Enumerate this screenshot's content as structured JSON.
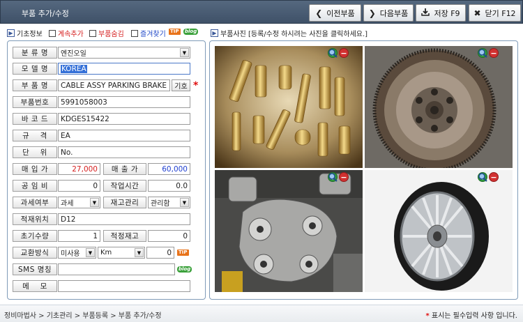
{
  "window": {
    "title": "부품 추가/수정"
  },
  "toolbar": {
    "prev": {
      "label": "이전부품",
      "icon": "chevron-left-icon"
    },
    "next": {
      "label": "다음부품",
      "icon": "chevron-right-icon"
    },
    "save": {
      "label": "저장 F9",
      "icon": "download-icon"
    },
    "close": {
      "label": "닫기 F12",
      "icon": "close-icon"
    }
  },
  "infobar": {
    "basic": "기초정보",
    "continue_add": "계속추가",
    "hide_part": "부품숨김",
    "favorite": "즐겨찾기",
    "tip": "TIP",
    "blog": "blog",
    "photo_hint": "부품사진 [등록/수정 하시려는 사진을 클릭하세요.]"
  },
  "form": {
    "category": {
      "label": "분 류 명",
      "value": "엔진오일"
    },
    "model": {
      "label": "모 델 명",
      "value": "KOREA"
    },
    "part_name": {
      "label": "부 품 명",
      "value": "CABLE ASSY PARKING BRAKE",
      "button": "기호",
      "required": "*"
    },
    "part_no": {
      "label": "부품번호",
      "value": "5991058003"
    },
    "barcode": {
      "label": "바 코 드",
      "value": "KDGES15422"
    },
    "spec": {
      "label": "규    격",
      "value": "EA"
    },
    "unit": {
      "label": "단    위",
      "value": "No."
    },
    "purchase_price": {
      "label": "매 입 가",
      "value": "27,000"
    },
    "sale_price": {
      "label": "매 출 가",
      "value": "60,000"
    },
    "labor_cost": {
      "label": "공 임 비",
      "value": "0"
    },
    "work_time": {
      "label": "작업시간",
      "value": "0.0"
    },
    "tax": {
      "label": "과세여부",
      "value": "과세"
    },
    "stock_mgmt": {
      "label": "재고관리",
      "value": "관리함"
    },
    "location": {
      "label": "적재위치",
      "value": "D12"
    },
    "init_qty": {
      "label": "초기수량",
      "value": "1"
    },
    "proper_stock": {
      "label": "적정재고",
      "value": "0"
    },
    "exchange": {
      "label": "교환방식",
      "mode": "미사용",
      "unit": "Km",
      "value": "0",
      "tip": "TIP"
    },
    "sms": {
      "label": "SMS 명칭",
      "value": "",
      "blog": "blog"
    },
    "memo": {
      "label": "메    모",
      "value": ""
    }
  },
  "photos": [
    {
      "name": "brass-fittings-photo"
    },
    {
      "name": "flywheel-photo"
    },
    {
      "name": "engine-pump-photo"
    },
    {
      "name": "alloy-wheel-photo"
    }
  ],
  "status": {
    "breadcrumb": "정비마법사 > 기초관리 > 부품등록 > 부품 추가/수정",
    "star": "*",
    "note": "표시는 필수입력 사항 입니다."
  }
}
